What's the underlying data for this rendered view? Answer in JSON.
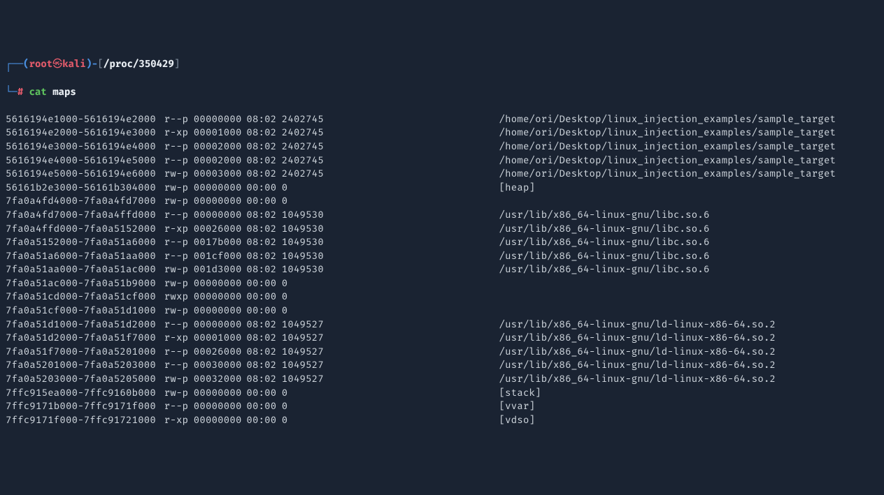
{
  "prompt": {
    "line1": {
      "corner": "┌──(",
      "user": "root",
      "skull": "㉿",
      "host": "kali",
      "close_paren": ")-",
      "open_br": "[",
      "cwd": "/proc/350429",
      "close_br": "]"
    },
    "line2": {
      "corner": "└─",
      "hash": "#",
      "space": " ",
      "cmd": "cat",
      "arg": " maps"
    }
  },
  "rows": [
    {
      "addr": "5616194e1000-5616194e2000",
      "perm": "r--p",
      "off": "00000000",
      "dev": "08:02",
      "ino": "2402745",
      "path": "/home/ori/Desktop/linux_injection_examples/sample_target"
    },
    {
      "addr": "5616194e2000-5616194e3000",
      "perm": "r-xp",
      "off": "00001000",
      "dev": "08:02",
      "ino": "2402745",
      "path": "/home/ori/Desktop/linux_injection_examples/sample_target"
    },
    {
      "addr": "5616194e3000-5616194e4000",
      "perm": "r--p",
      "off": "00002000",
      "dev": "08:02",
      "ino": "2402745",
      "path": "/home/ori/Desktop/linux_injection_examples/sample_target"
    },
    {
      "addr": "5616194e4000-5616194e5000",
      "perm": "r--p",
      "off": "00002000",
      "dev": "08:02",
      "ino": "2402745",
      "path": "/home/ori/Desktop/linux_injection_examples/sample_target"
    },
    {
      "addr": "5616194e5000-5616194e6000",
      "perm": "rw-p",
      "off": "00003000",
      "dev": "08:02",
      "ino": "2402745",
      "path": "/home/ori/Desktop/linux_injection_examples/sample_target"
    },
    {
      "addr": "56161b2e3000-56161b304000",
      "perm": "rw-p",
      "off": "00000000",
      "dev": "00:00",
      "ino": "0",
      "path": "[heap]"
    },
    {
      "addr": "7fa0a4fd4000-7fa0a4fd7000",
      "perm": "rw-p",
      "off": "00000000",
      "dev": "00:00",
      "ino": "0",
      "path": ""
    },
    {
      "addr": "7fa0a4fd7000-7fa0a4ffd000",
      "perm": "r--p",
      "off": "00000000",
      "dev": "08:02",
      "ino": "1049530",
      "path": "/usr/lib/x86_64-linux-gnu/libc.so.6"
    },
    {
      "addr": "7fa0a4ffd000-7fa0a5152000",
      "perm": "r-xp",
      "off": "00026000",
      "dev": "08:02",
      "ino": "1049530",
      "path": "/usr/lib/x86_64-linux-gnu/libc.so.6"
    },
    {
      "addr": "7fa0a5152000-7fa0a51a6000",
      "perm": "r--p",
      "off": "0017b000",
      "dev": "08:02",
      "ino": "1049530",
      "path": "/usr/lib/x86_64-linux-gnu/libc.so.6"
    },
    {
      "addr": "7fa0a51a6000-7fa0a51aa000",
      "perm": "r--p",
      "off": "001cf000",
      "dev": "08:02",
      "ino": "1049530",
      "path": "/usr/lib/x86_64-linux-gnu/libc.so.6"
    },
    {
      "addr": "7fa0a51aa000-7fa0a51ac000",
      "perm": "rw-p",
      "off": "001d3000",
      "dev": "08:02",
      "ino": "1049530",
      "path": "/usr/lib/x86_64-linux-gnu/libc.so.6"
    },
    {
      "addr": "7fa0a51ac000-7fa0a51b9000",
      "perm": "rw-p",
      "off": "00000000",
      "dev": "00:00",
      "ino": "0",
      "path": ""
    },
    {
      "addr": "7fa0a51cd000-7fa0a51cf000",
      "perm": "rwxp",
      "off": "00000000",
      "dev": "00:00",
      "ino": "0",
      "path": ""
    },
    {
      "addr": "7fa0a51cf000-7fa0a51d1000",
      "perm": "rw-p",
      "off": "00000000",
      "dev": "00:00",
      "ino": "0",
      "path": ""
    },
    {
      "addr": "7fa0a51d1000-7fa0a51d2000",
      "perm": "r--p",
      "off": "00000000",
      "dev": "08:02",
      "ino": "1049527",
      "path": "/usr/lib/x86_64-linux-gnu/ld-linux-x86-64.so.2"
    },
    {
      "addr": "7fa0a51d2000-7fa0a51f7000",
      "perm": "r-xp",
      "off": "00001000",
      "dev": "08:02",
      "ino": "1049527",
      "path": "/usr/lib/x86_64-linux-gnu/ld-linux-x86-64.so.2"
    },
    {
      "addr": "7fa0a51f7000-7fa0a5201000",
      "perm": "r--p",
      "off": "00026000",
      "dev": "08:02",
      "ino": "1049527",
      "path": "/usr/lib/x86_64-linux-gnu/ld-linux-x86-64.so.2"
    },
    {
      "addr": "7fa0a5201000-7fa0a5203000",
      "perm": "r--p",
      "off": "00030000",
      "dev": "08:02",
      "ino": "1049527",
      "path": "/usr/lib/x86_64-linux-gnu/ld-linux-x86-64.so.2"
    },
    {
      "addr": "7fa0a5203000-7fa0a5205000",
      "perm": "rw-p",
      "off": "00032000",
      "dev": "08:02",
      "ino": "1049527",
      "path": "/usr/lib/x86_64-linux-gnu/ld-linux-x86-64.so.2"
    },
    {
      "addr": "7ffc915ea000-7ffc9160b000",
      "perm": "rw-p",
      "off": "00000000",
      "dev": "00:00",
      "ino": "0",
      "path": "[stack]"
    },
    {
      "addr": "7ffc9171b000-7ffc9171f000",
      "perm": "r--p",
      "off": "00000000",
      "dev": "00:00",
      "ino": "0",
      "path": "[vvar]"
    },
    {
      "addr": "7ffc9171f000-7ffc91721000",
      "perm": "r-xp",
      "off": "00000000",
      "dev": "00:00",
      "ino": "0",
      "path": "[vdso]"
    }
  ]
}
